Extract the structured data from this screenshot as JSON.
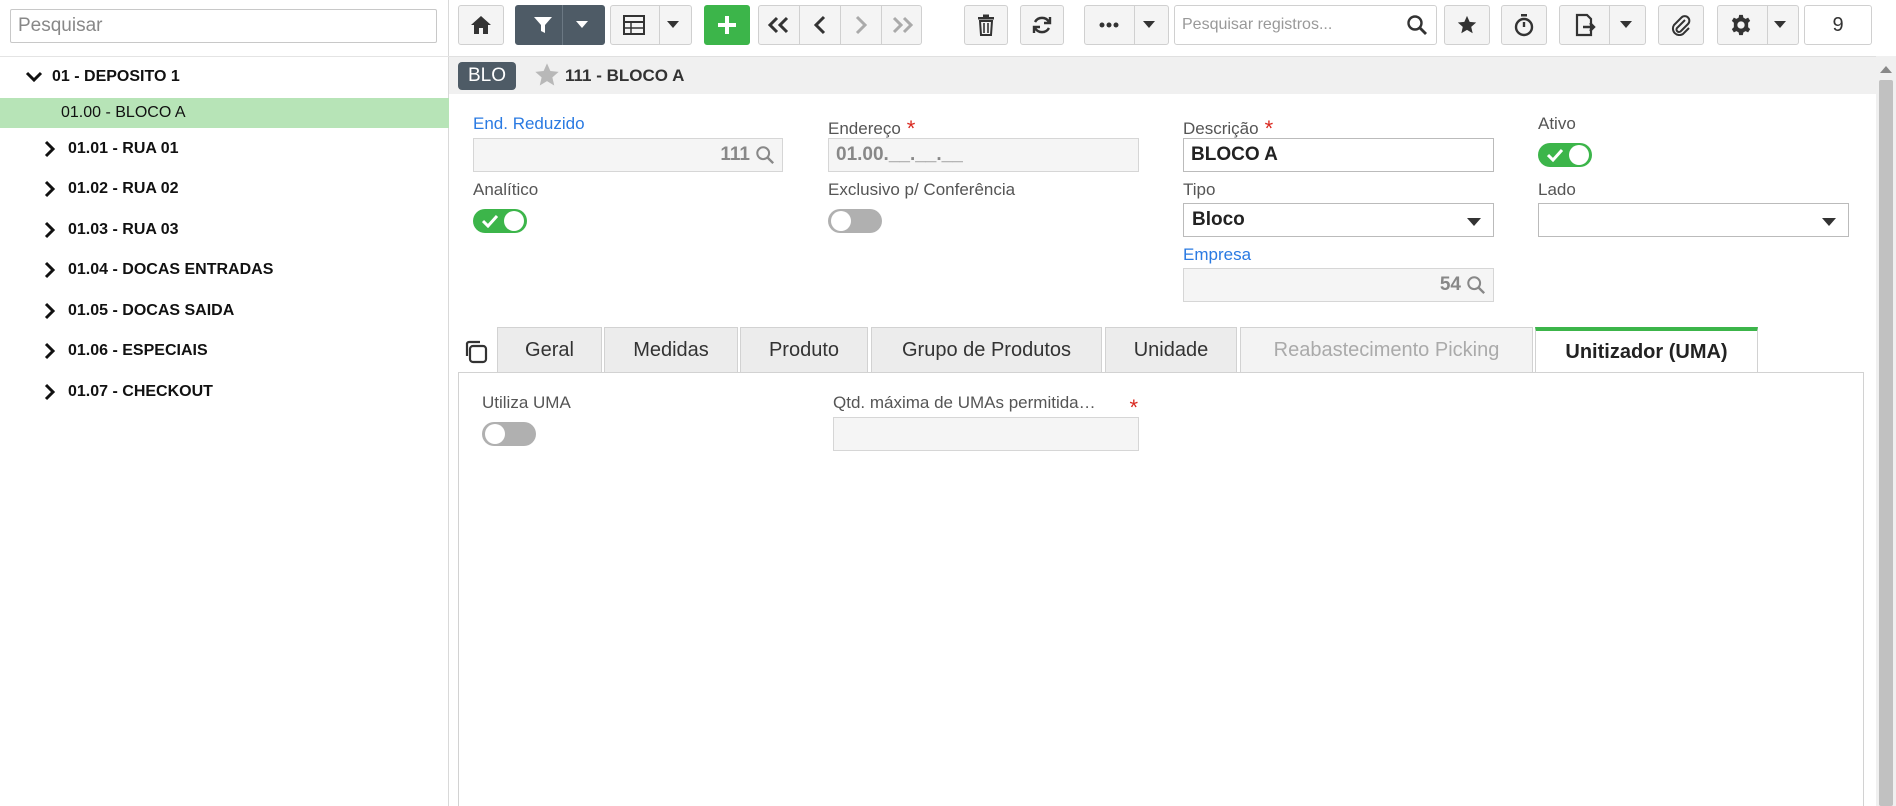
{
  "sidebar": {
    "search_placeholder": "Pesquisar",
    "tree": [
      {
        "label": "01 - DEPOSITO 1",
        "state": "expanded"
      },
      {
        "label": "01.00 - BLOCO A",
        "state": "selected"
      },
      {
        "label": "01.01 - RUA 01",
        "state": "collapsed"
      },
      {
        "label": "01.02 - RUA 02",
        "state": "collapsed"
      },
      {
        "label": "01.03 - RUA 03",
        "state": "collapsed"
      },
      {
        "label": "01.04 - DOCAS ENTRADAS",
        "state": "collapsed"
      },
      {
        "label": "01.05 - DOCAS SAIDA",
        "state": "collapsed"
      },
      {
        "label": "01.06 - ESPECIAIS",
        "state": "collapsed"
      },
      {
        "label": "01.07 - CHECKOUT",
        "state": "collapsed"
      }
    ]
  },
  "toolbar": {
    "search_placeholder": "Pesquisar registros...",
    "record_count": "9",
    "icons": [
      "home-icon",
      "filter-icon",
      "grid-icon",
      "add-icon",
      "first-icon",
      "prev-icon",
      "next-icon",
      "last-icon",
      "delete-icon",
      "refresh-icon",
      "more-icon",
      "search-icon",
      "star-icon",
      "stopwatch-icon",
      "export-icon",
      "attach-icon",
      "gear-icon"
    ]
  },
  "record": {
    "badge": "BLO",
    "title": "111 - BLOCO A"
  },
  "form": {
    "end_reduzido": {
      "label": "End. Reduzido",
      "value": "111"
    },
    "endereco": {
      "label": "Endereço",
      "value": "01.00.__.__.__",
      "required": "*"
    },
    "descricao": {
      "label": "Descrição",
      "value": "BLOCO A",
      "required": "*"
    },
    "ativo": {
      "label": "Ativo",
      "on": true
    },
    "analitico": {
      "label": "Analítico",
      "on": true
    },
    "exclusivo": {
      "label": "Exclusivo p/ Conferência",
      "on": false
    },
    "tipo": {
      "label": "Tipo",
      "value": "Bloco"
    },
    "lado": {
      "label": "Lado",
      "value": ""
    },
    "empresa": {
      "label": "Empresa",
      "value": "54"
    }
  },
  "tabs": [
    {
      "label": "Geral",
      "state": "normal"
    },
    {
      "label": "Medidas",
      "state": "normal"
    },
    {
      "label": "Produto",
      "state": "normal"
    },
    {
      "label": "Grupo de Produtos",
      "state": "normal"
    },
    {
      "label": "Unidade",
      "state": "normal"
    },
    {
      "label": "Reabastecimento Picking",
      "state": "disabled"
    },
    {
      "label": "Unitizador (UMA)",
      "state": "active"
    }
  ],
  "tab_content": {
    "utiliza_uma": {
      "label": "Utiliza UMA",
      "on": false
    },
    "qtd_max": {
      "label": "Qtd. máxima de UMAs permitida…",
      "required": "*",
      "value": ""
    }
  },
  "colors": {
    "accent": "#3cb54a",
    "dark": "#4e5b66",
    "link": "#2a7ae2",
    "required": "#d9281f",
    "selected_row": "#b7e4b7"
  }
}
